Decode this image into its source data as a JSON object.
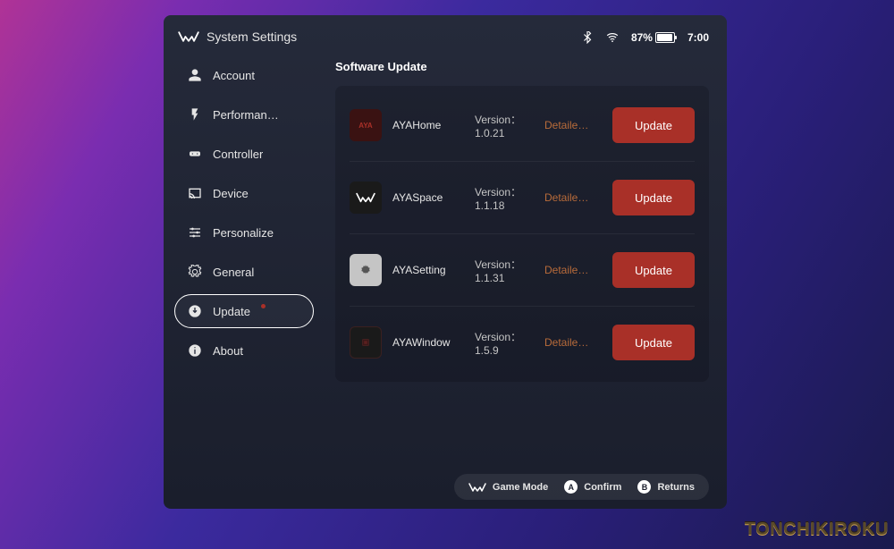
{
  "header": {
    "title": "System Settings"
  },
  "status": {
    "battery_percent": "87%",
    "time": "7:00"
  },
  "sidebar": {
    "items": [
      {
        "label": "Account",
        "icon": "user-icon"
      },
      {
        "label": "Performan…",
        "icon": "bolt-icon"
      },
      {
        "label": "Controller",
        "icon": "gamepad-icon"
      },
      {
        "label": "Device",
        "icon": "cast-icon"
      },
      {
        "label": "Personalize",
        "icon": "sliders-icon"
      },
      {
        "label": "General",
        "icon": "gear-icon"
      },
      {
        "label": "Update",
        "icon": "download-icon",
        "active": true,
        "badge": true
      },
      {
        "label": "About",
        "icon": "info-icon"
      }
    ]
  },
  "main": {
    "title": "Software Update",
    "version_label": "Version",
    "detailed_label": "Detailed…",
    "update_button": "Update",
    "apps": [
      {
        "name": "AYAHome",
        "version": "1.0.21",
        "icon_type": "red",
        "icon_text": "AYA"
      },
      {
        "name": "AYASpace",
        "version": "1.1.18",
        "icon_type": "dark",
        "icon_text": "logo"
      },
      {
        "name": "AYASetting",
        "version": "1.1.31",
        "icon_type": "gray",
        "icon_text": "gear"
      },
      {
        "name": "AYAWindow",
        "version": "1.5.9",
        "icon_type": "chip",
        "icon_text": ""
      }
    ]
  },
  "footer": {
    "game_mode": "Game Mode",
    "confirm": "Confirm",
    "returns": "Returns"
  },
  "watermark": "TONCHIKIROKU"
}
